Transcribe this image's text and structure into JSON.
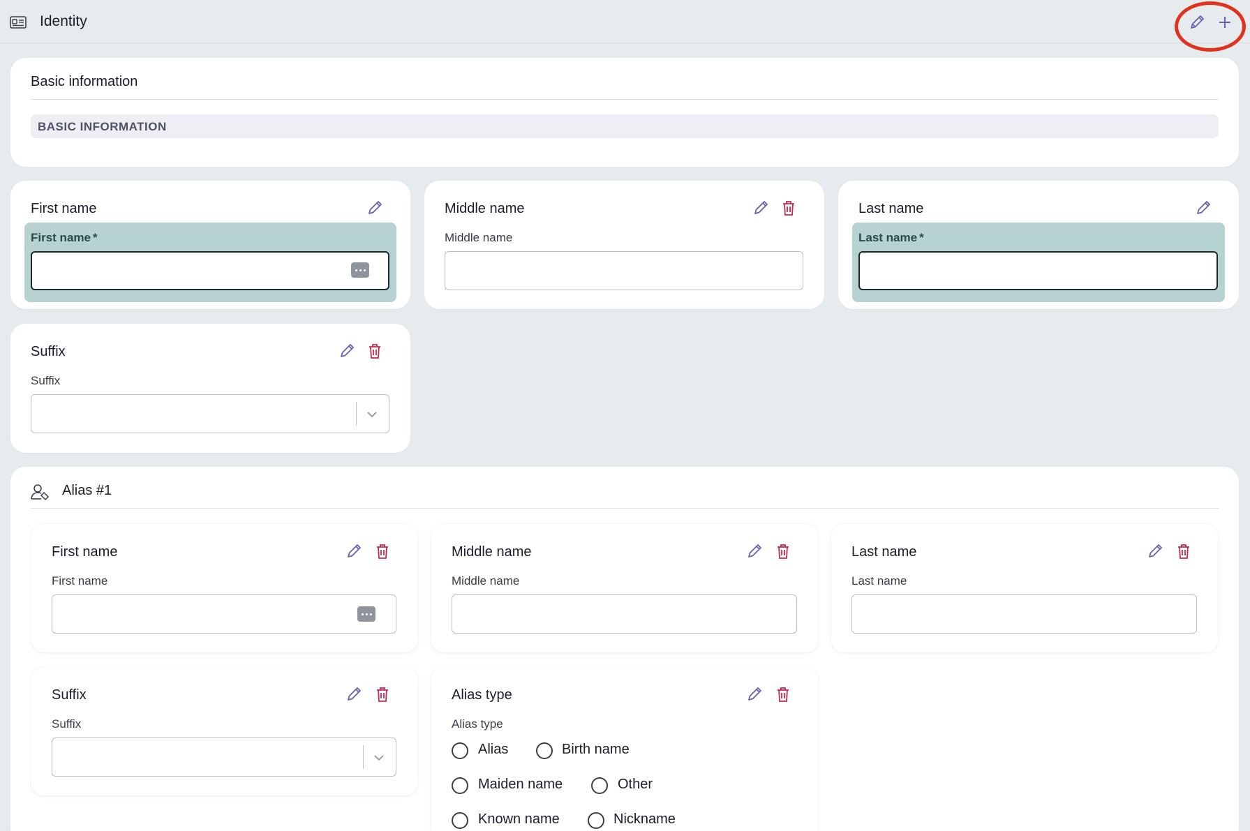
{
  "header": {
    "title": "Identity",
    "icon": "id-card-icon"
  },
  "basic": {
    "card_title": "Basic information",
    "band_label": "BASIC INFORMATION"
  },
  "fields": {
    "first_name": {
      "title": "First name",
      "label": "First name",
      "required_mark": "*",
      "value": ""
    },
    "middle_name": {
      "title": "Middle name",
      "label": "Middle name",
      "value": ""
    },
    "last_name": {
      "title": "Last name",
      "label": "Last name",
      "required_mark": "*",
      "value": ""
    },
    "suffix": {
      "title": "Suffix",
      "label": "Suffix",
      "value": ""
    }
  },
  "alias": {
    "title": "Alias #1",
    "icon": "user-tag-icon",
    "first_name": {
      "title": "First name",
      "label": "First name",
      "value": ""
    },
    "middle_name": {
      "title": "Middle name",
      "label": "Middle name",
      "value": ""
    },
    "last_name": {
      "title": "Last name",
      "label": "Last name",
      "value": ""
    },
    "suffix": {
      "title": "Suffix",
      "label": "Suffix",
      "value": ""
    },
    "alias_type": {
      "title": "Alias type",
      "label": "Alias type",
      "options": [
        "Alias",
        "Birth name",
        "Maiden name",
        "Other",
        "Known name",
        "Nickname"
      ]
    }
  },
  "colors": {
    "edit_icon": "#6b5fb0",
    "delete_icon": "#c8284f",
    "required_band": "#b6d2d1",
    "highlight": "#e0321c"
  }
}
